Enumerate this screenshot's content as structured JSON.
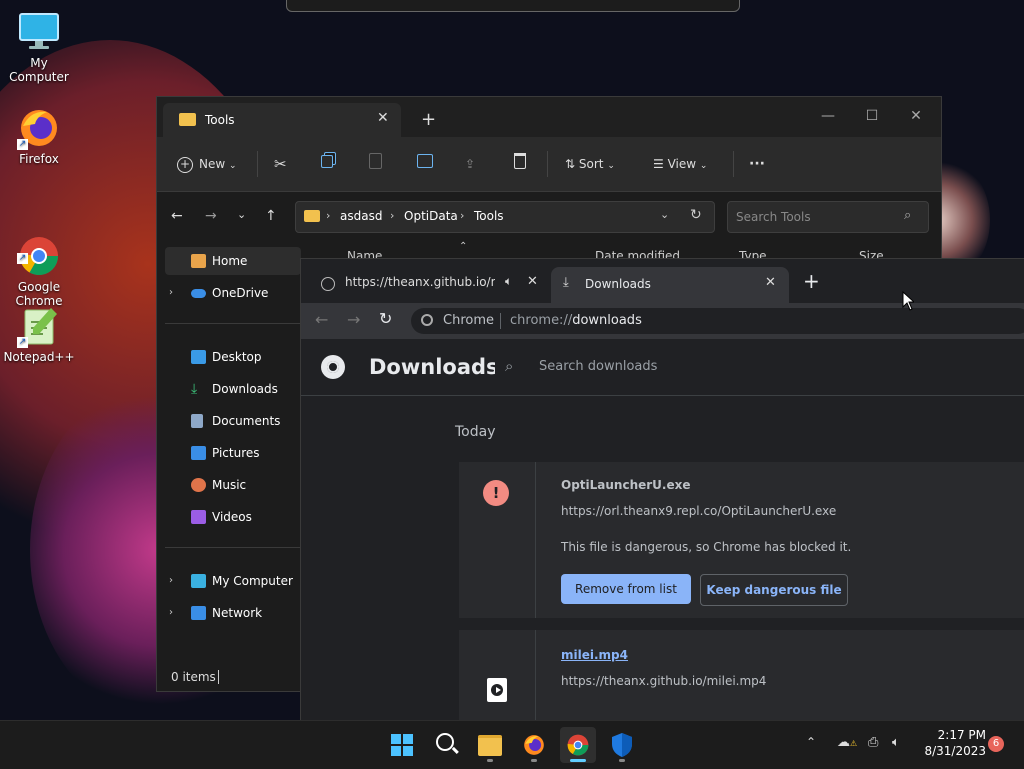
{
  "desktop": {
    "icons": [
      {
        "label": "My Computer",
        "icon": "monitor-icon"
      },
      {
        "label": "Firefox",
        "icon": "firefox-icon"
      },
      {
        "label": "Google\nChrome",
        "icon": "chrome-icon"
      },
      {
        "label": "Notepad++",
        "icon": "notepadpp-icon"
      }
    ]
  },
  "explorer": {
    "tab_title": "Tools",
    "toolbar": {
      "new": "New",
      "sort": "Sort",
      "view": "View",
      "more": "···"
    },
    "breadcrumb": [
      "asdasd",
      "OptiData",
      "Tools"
    ],
    "search_placeholder": "Search Tools",
    "sidebar": {
      "home": "Home",
      "onedrive": "OneDrive",
      "quick": [
        "Desktop",
        "Downloads",
        "Documents",
        "Pictures",
        "Music",
        "Videos"
      ],
      "my_computer": "My Computer",
      "network": "Network"
    },
    "columns": [
      "Name",
      "Date modified",
      "Type",
      "Size"
    ],
    "status": "0 items"
  },
  "chrome": {
    "tabs": [
      {
        "title": "https://theanx.github.io/milei",
        "active": false,
        "audio": true
      },
      {
        "title": "Downloads",
        "active": true
      }
    ],
    "omnibox": {
      "site": "Chrome",
      "url_prefix": "chrome://",
      "url_path": "downloads"
    },
    "page_title": "Downloads",
    "search_placeholder": "Search downloads",
    "section": "Today",
    "items": [
      {
        "file": "OptiLauncherU.exe",
        "url": "https://orl.theanx9.repl.co/OptiLauncherU.exe",
        "message": "This file is dangerous, so Chrome has blocked it.",
        "remove_label": "Remove from list",
        "keep_label": "Keep dangerous file"
      },
      {
        "file": "milei.mp4",
        "url": "https://theanx.github.io/milei.mp4"
      }
    ]
  },
  "taskbar": {
    "time": "2:17 PM",
    "date": "8/31/2023",
    "notifications": "6"
  },
  "colors": {
    "accent": "#8ab4f8",
    "danger": "#f28b82",
    "taskbar_active": "#60cdff"
  }
}
